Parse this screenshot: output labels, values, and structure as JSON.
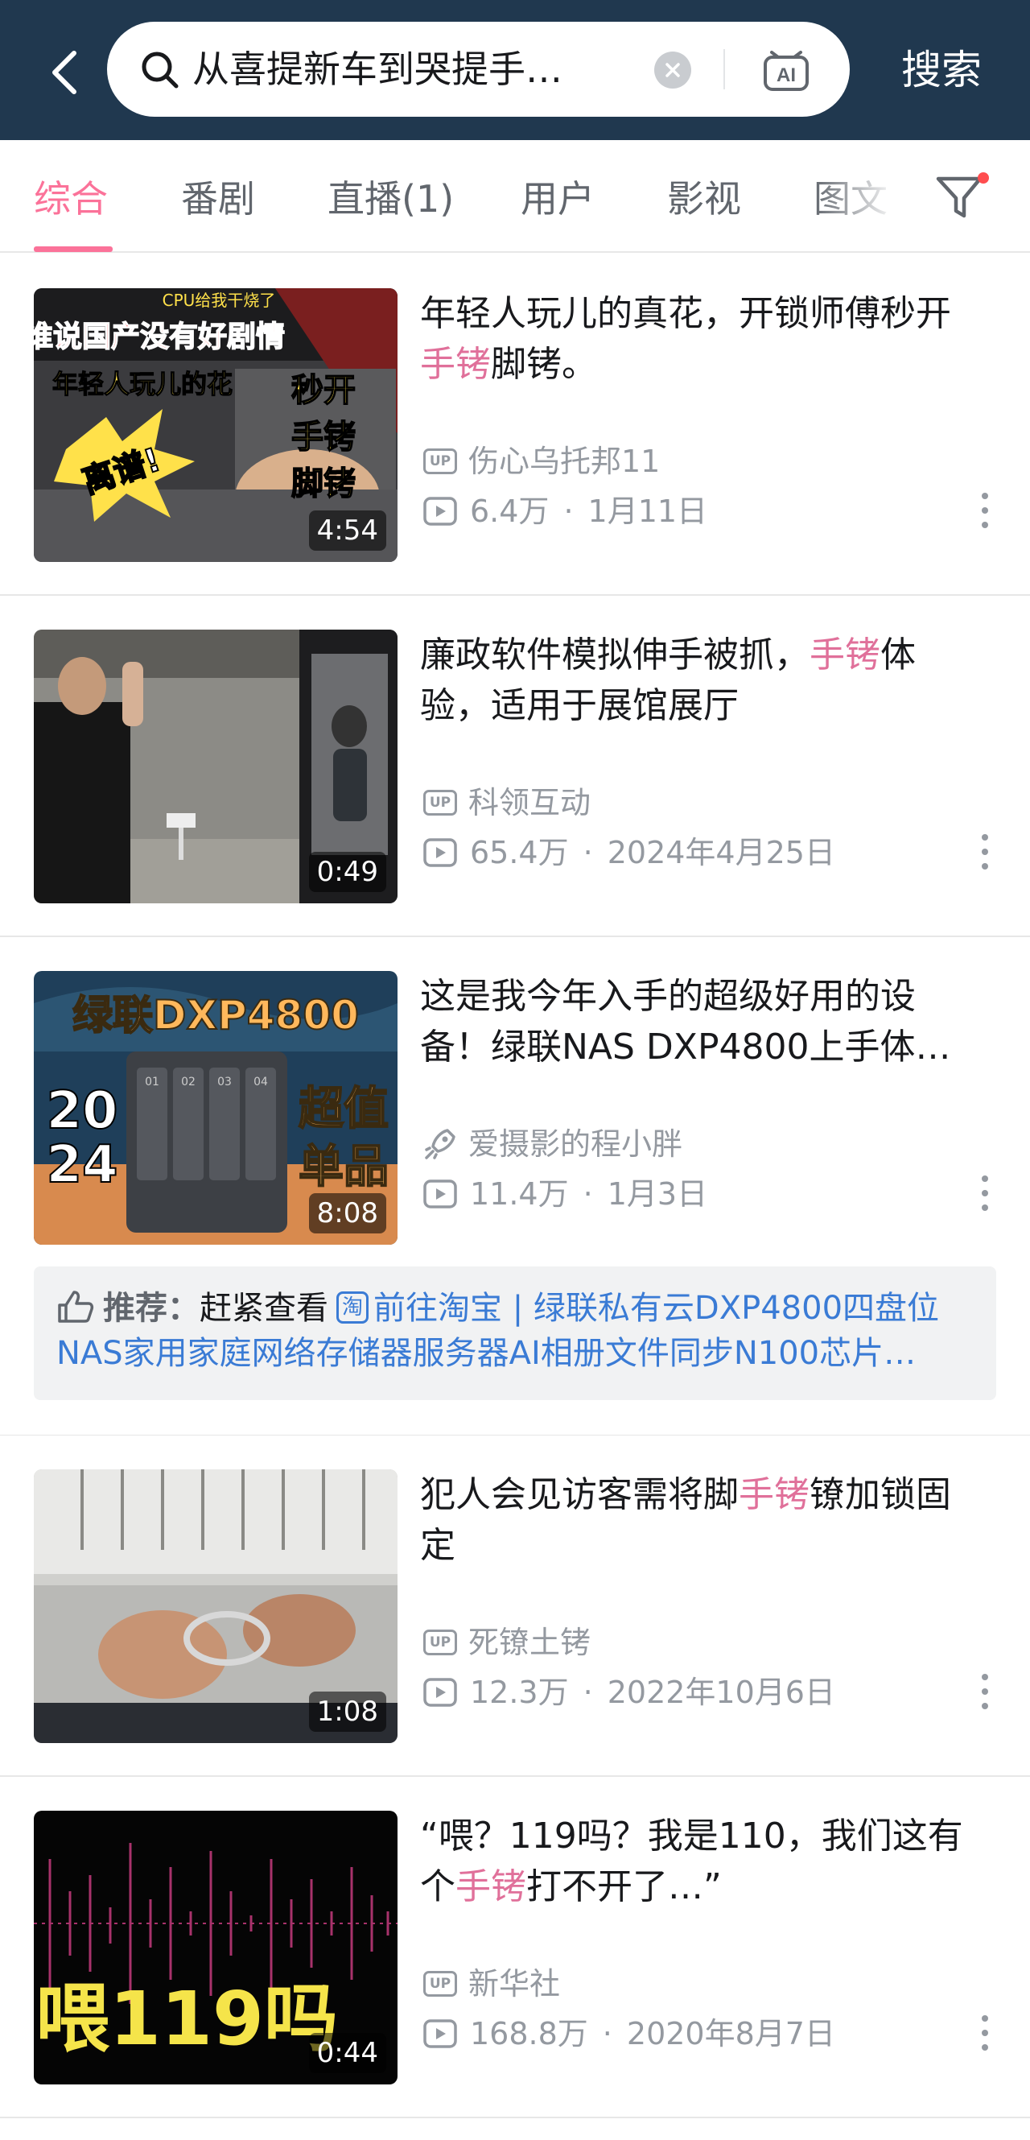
{
  "search": {
    "query": "从喜提新车到哭提手…",
    "button_label": "搜索",
    "ai_label": "AI"
  },
  "tabs": [
    {
      "label": "综合",
      "active": true
    },
    {
      "label": "番剧"
    },
    {
      "label": "直播(1)"
    },
    {
      "label": "用户"
    },
    {
      "label": "影视"
    },
    {
      "label": "图文"
    }
  ],
  "accent_color": "#fb7299",
  "link_color": "#3a7bd5",
  "results": [
    {
      "title_parts": [
        "年轻人玩儿的真花，开锁师傅秒开",
        "手铐",
        "脚铐。"
      ],
      "uploader": "伤心乌托邦11",
      "uploader_badge": "UP",
      "views": "6.4万",
      "date": "1月11日",
      "duration": "4:54",
      "thumb_text": [
        "CPU给我干烧了",
        "谁说国产没有好剧情",
        "年轻人玩儿的花",
        "秒开",
        "手铐",
        "脚铐",
        "离谱!"
      ]
    },
    {
      "title_parts": [
        "廉政软件模拟伸手被抓，",
        "手铐",
        "体验，适用于展馆展厅"
      ],
      "uploader": "科领互动",
      "uploader_badge": "UP",
      "views": "65.4万",
      "date": "2024年4月25日",
      "duration": "0:49"
    },
    {
      "title_parts": [
        "这是我今年入手的超级好用的设备！绿联NAS DXP4800上手体…",
        "",
        ""
      ],
      "uploader": "爱摄影的程小胖",
      "uploader_badge": "rocket",
      "views": "11.4万",
      "date": "1月3日",
      "duration": "8:08",
      "thumb_text": [
        "绿联DXP4800",
        "20",
        "24",
        "超值",
        "单品",
        "01",
        "02",
        "03",
        "04"
      ]
    },
    {
      "title_parts": [
        "犯人会见访客需将脚",
        "手铐",
        "镣加锁固定"
      ],
      "uploader": "死镣土铐",
      "uploader_badge": "UP",
      "views": "12.3万",
      "date": "2022年10月6日",
      "duration": "1:08"
    },
    {
      "title_parts": [
        "“喂？119吗？我是110，我们这有个",
        "手铐",
        "打不开了…”"
      ],
      "uploader": "新华社",
      "uploader_badge": "UP",
      "views": "168.8万",
      "date": "2020年8月7日",
      "duration": "0:44",
      "thumb_text": [
        "喂119吗"
      ]
    }
  ],
  "recommendation": {
    "label": "推荐：",
    "prefix": "赶紧查看",
    "badge": "淘",
    "link_text": "前往淘宝 | 绿联私有云DXP4800四盘位NAS家用家庭网络存储器服务器AI相册文件同步N100芯片…"
  }
}
